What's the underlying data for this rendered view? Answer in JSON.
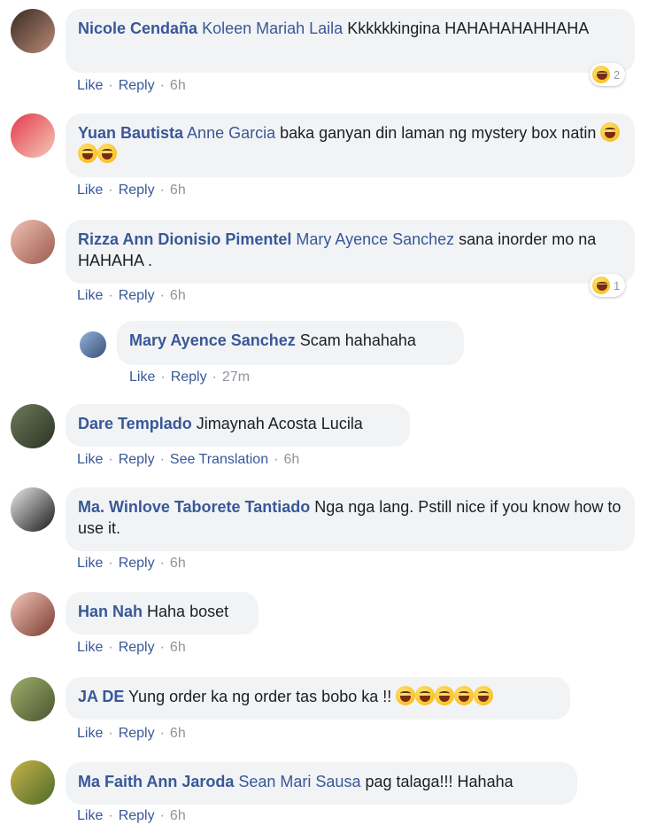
{
  "actions": {
    "like": "Like",
    "reply": "Reply",
    "see_translation": "See Translation"
  },
  "comments": [
    {
      "author": "Nicole Cendaña",
      "tag": "Koleen Mariah Laila",
      "text": "Kkkkkkingina HAHAHAHAHHAHA",
      "time": "6h",
      "reaction_count": "2"
    },
    {
      "author": "Yuan Bautista",
      "tag": "Anne Garcia",
      "text": "baka ganyan din laman ng mystery box natin",
      "time": "6h"
    },
    {
      "author": "Rizza Ann Dionisio Pimentel",
      "tag": "Mary Ayence Sanchez",
      "text": "sana inorder mo na HAHAHA .",
      "time": "6h",
      "reaction_count": "1"
    },
    {
      "author": "Mary Ayence Sanchez",
      "tag": "",
      "text": "Scam hahahaha",
      "time": "27m"
    },
    {
      "author": "Dare Templado",
      "tag": "",
      "text": "Jimaynah Acosta Lucila",
      "time": "6h"
    },
    {
      "author": "Ma. Winlove Taborete Tantiado",
      "tag": "",
      "text": "Nga nga lang. Pstill nice if you know how to use it.",
      "time": "6h"
    },
    {
      "author": "Han Nah",
      "tag": "",
      "text": "Haha boset",
      "time": "6h"
    },
    {
      "author": "JA DE",
      "tag": "",
      "text": "Yung order ka ng order tas bobo ka !!",
      "time": "6h"
    },
    {
      "author": "Ma Faith Ann Jaroda",
      "tag": "Sean Mari Sausa",
      "text": "pag talaga!!! Hahaha",
      "time": "6h"
    }
  ],
  "icons": {
    "reaction": "laugh-emoji-icon",
    "rofl": "rofl-emoji-icon",
    "grin": "grin-emoji-icon",
    "tears": "tears-of-joy-emoji-icon"
  },
  "colors": {
    "link": "#385898",
    "bubble": "#f2f3f5",
    "meta": "#90949c"
  }
}
